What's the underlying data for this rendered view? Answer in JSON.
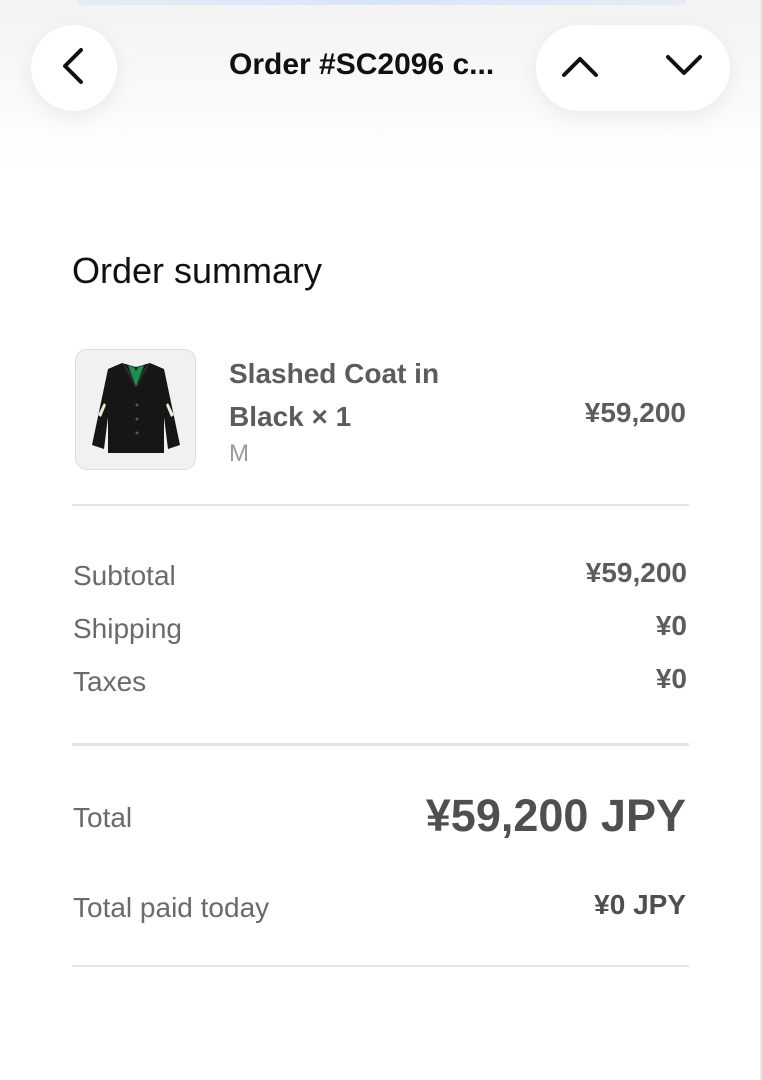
{
  "nav": {
    "title": "Order #SC2096 c...",
    "back_icon": "chevron-left-icon",
    "up_icon": "chevron-up-icon",
    "down_icon": "chevron-down-icon"
  },
  "summary": {
    "title": "Order summary",
    "item": {
      "name": "Slashed Coat in Black × 1",
      "variant": "M",
      "price": "¥59,200",
      "image_icon": "coat-product-image"
    },
    "rows": [
      {
        "label": "Subtotal",
        "value": "¥59,200"
      },
      {
        "label": "Shipping",
        "value": "¥0"
      },
      {
        "label": "Taxes",
        "value": "¥0"
      }
    ],
    "total": {
      "label": "Total",
      "value": "¥59,200 JPY"
    },
    "paid_today": {
      "label": "Total paid today",
      "value": "¥0 JPY"
    }
  },
  "colors": {
    "text_dark": "#111111",
    "text_muted": "#6a6a6a",
    "divider": "#e3e3e3",
    "coat_lining": "#1d8f4e",
    "coat_slash": "#e4efd6"
  }
}
